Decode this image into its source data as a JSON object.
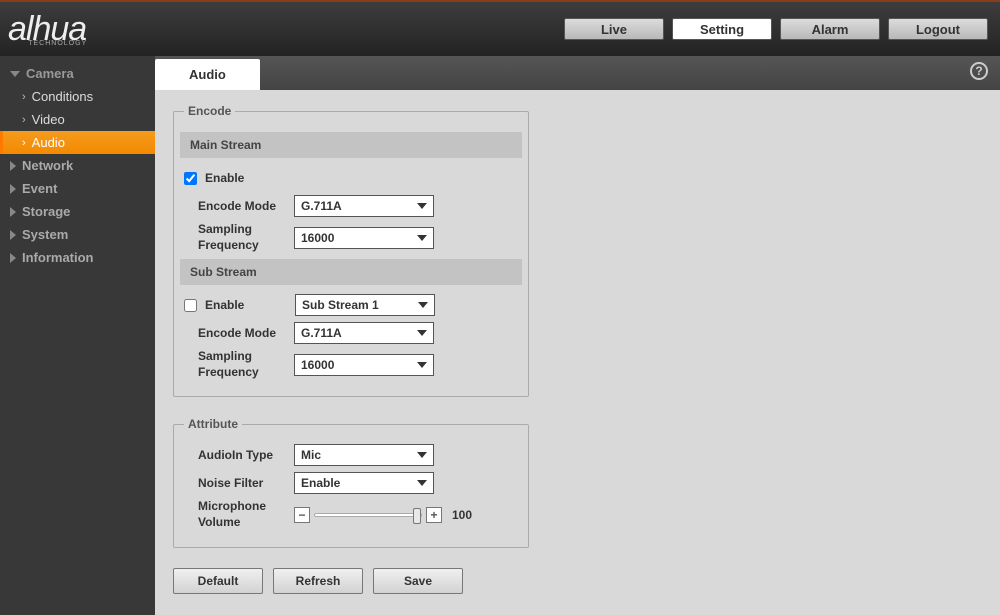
{
  "brand": {
    "name": "alhua",
    "sub": "TECHNOLOGY"
  },
  "topnav": {
    "live": "Live",
    "setting": "Setting",
    "alarm": "Alarm",
    "logout": "Logout"
  },
  "sidebar": {
    "camera": "Camera",
    "camera_items": {
      "conditions": "Conditions",
      "video": "Video",
      "audio": "Audio"
    },
    "network": "Network",
    "event": "Event",
    "storage": "Storage",
    "system": "System",
    "information": "Information"
  },
  "tab": {
    "audio": "Audio"
  },
  "encode": {
    "legend": "Encode",
    "main_section": "Main Stream",
    "sub_section": "Sub Stream",
    "enable_label": "Enable",
    "encode_mode_label": "Encode Mode",
    "sampling_label": "Sampling Frequency",
    "main": {
      "enabled": true,
      "mode": "G.711A",
      "sampling": "16000"
    },
    "sub": {
      "enabled": false,
      "stream": "Sub Stream 1",
      "mode": "G.711A",
      "sampling": "16000"
    }
  },
  "attribute": {
    "legend": "Attribute",
    "audioin_label": "AudioIn Type",
    "audioin_value": "Mic",
    "noise_label": "Noise Filter",
    "noise_value": "Enable",
    "micvol_label": "Microphone Volume",
    "micvol_value": "100"
  },
  "buttons": {
    "default": "Default",
    "refresh": "Refresh",
    "save": "Save"
  }
}
